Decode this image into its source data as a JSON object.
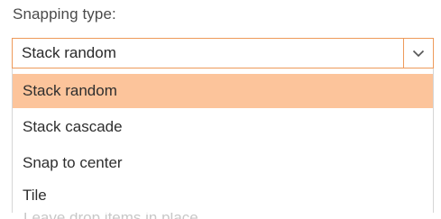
{
  "field": {
    "label": "Snapping type:",
    "selected_value": "Stack random",
    "arrow_icon": "chevron-down-icon"
  },
  "dropdown": {
    "options": [
      {
        "label": "Stack random",
        "selected": true
      },
      {
        "label": "Stack cascade",
        "selected": false
      },
      {
        "label": "Snap to center",
        "selected": false
      },
      {
        "label": "Tile",
        "selected": false
      }
    ]
  },
  "background": {
    "obscured_text": "Leave drop items in place"
  },
  "colors": {
    "accent_border": "#ee9a5a",
    "selected_bg": "#fcc49b"
  }
}
